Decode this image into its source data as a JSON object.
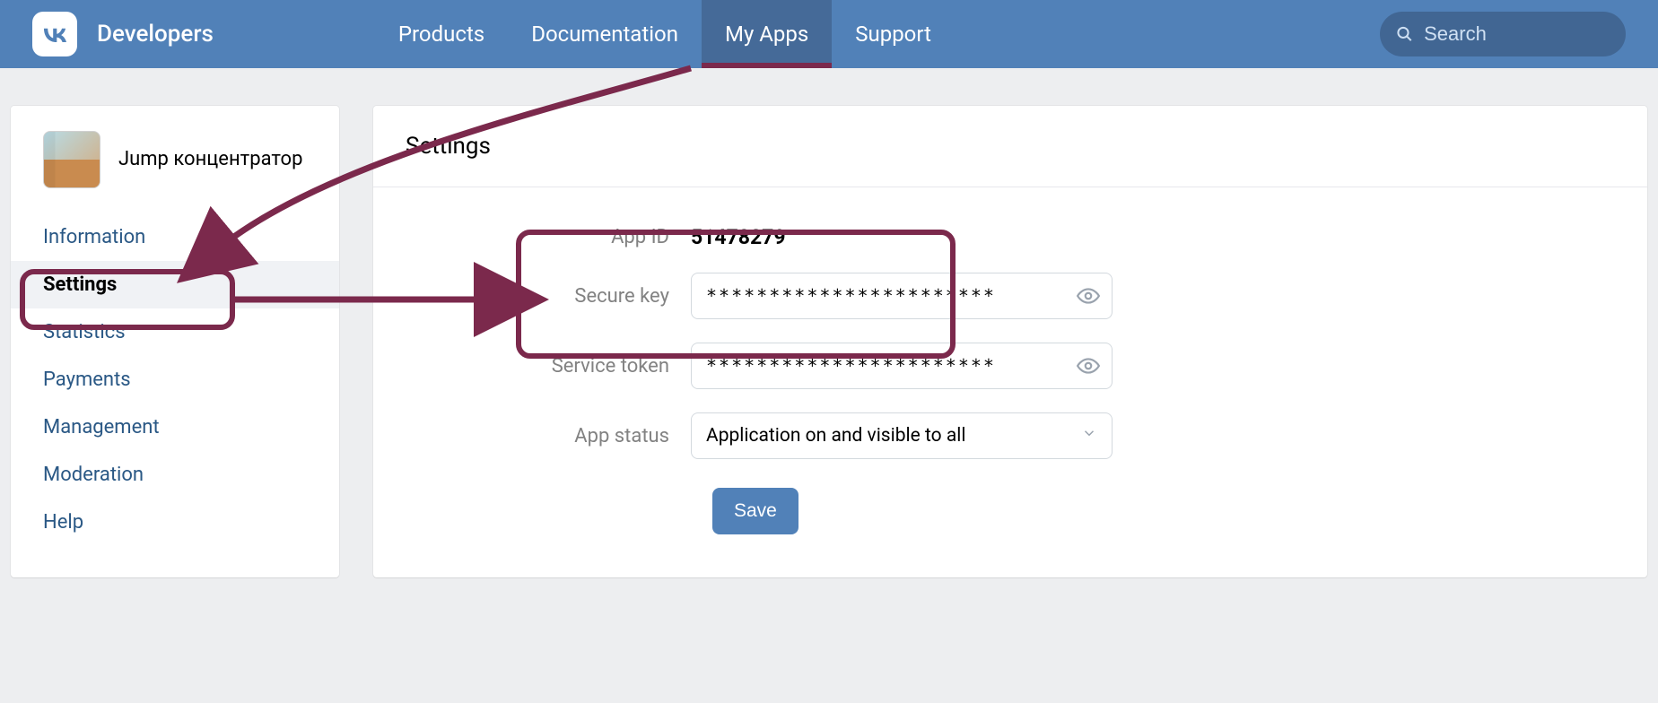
{
  "header": {
    "brand": "Developers",
    "nav": {
      "products": "Products",
      "documentation": "Documentation",
      "my_apps": "My Apps",
      "support": "Support"
    },
    "search_placeholder": "Search"
  },
  "sidebar": {
    "app_name": "Jump концентратор",
    "items": {
      "information": "Information",
      "settings": "Settings",
      "statistics": "Statistics",
      "payments": "Payments",
      "management": "Management",
      "moderation": "Moderation",
      "help": "Help"
    }
  },
  "main": {
    "title": "Settings",
    "labels": {
      "app_id": "App ID",
      "secure_key": "Secure key",
      "service_token": "Service token",
      "app_status": "App status"
    },
    "values": {
      "app_id": "51478279",
      "secure_key": "***********************",
      "service_token": "***********************",
      "app_status": "Application on and visible to all"
    },
    "save_label": "Save"
  }
}
